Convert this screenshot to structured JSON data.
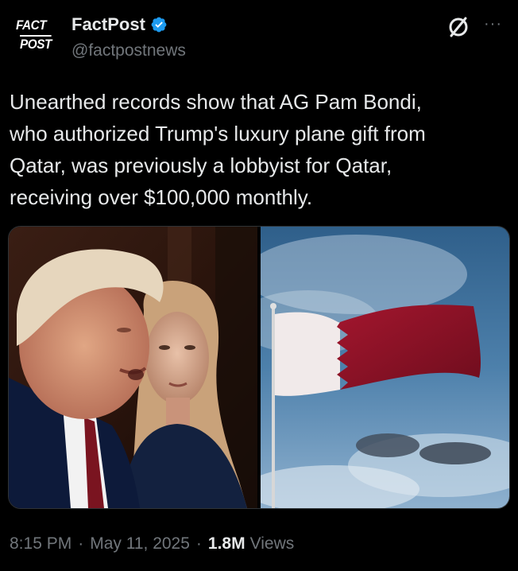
{
  "avatar": {
    "line1": "FACT",
    "line2": "POST"
  },
  "account": {
    "display_name": "FactPost",
    "handle": "@factpostnews"
  },
  "icons": {
    "verified": "verified-badge-icon",
    "null": "grok-null-icon",
    "more": "more-icon"
  },
  "more_label": "···",
  "tweet": {
    "text": "Unearthed records show that AG Pam Bondi,\nwho authorized Trump's luxury plane gift from\nQatar, was previously a lobbyist for Qatar,\nreceiving over $100,000 monthly."
  },
  "media": [
    {
      "name": "photo-trump-bondi"
    },
    {
      "name": "photo-qatar-flag"
    }
  ],
  "meta": {
    "time": "8:15 PM",
    "separator": "·",
    "date": "May 11, 2025",
    "views_count": "1.8M",
    "views_label": "Views"
  },
  "colors": {
    "background": "#000000",
    "text": "#e7e9ea",
    "muted": "#71767b",
    "accent": "#1d9bf0"
  }
}
